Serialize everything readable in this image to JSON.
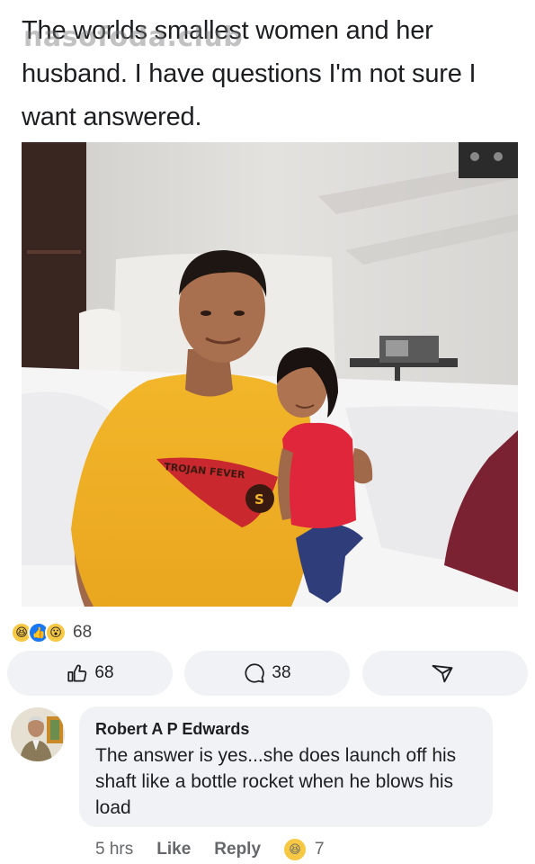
{
  "post": {
    "text": "The worlds smallest women and her husband. I have questions I'm not sure I want answered.",
    "watermark": "nasofoda.club"
  },
  "photo": {
    "shirt_print": "TROJAN FEVER",
    "shirt_badge": "S"
  },
  "reactions": {
    "icons": [
      "haha-icon",
      "like-icon",
      "wow-icon"
    ],
    "count": "68"
  },
  "actions": {
    "like_count": "68",
    "comment_count": "38"
  },
  "comment": {
    "author": "Robert A P Edwards",
    "text": "The answer is yes...she does launch off his shaft like a bottle rocket when he blows his load",
    "time": "5 hrs",
    "like_label": "Like",
    "reply_label": "Reply",
    "reaction_count": "7"
  },
  "colors": {
    "text": "#1c1e21",
    "meta": "#65676b",
    "pill_bg": "#f0f2f5",
    "like_blue": "#1877f2",
    "haha_yellow": "#f7c843"
  }
}
